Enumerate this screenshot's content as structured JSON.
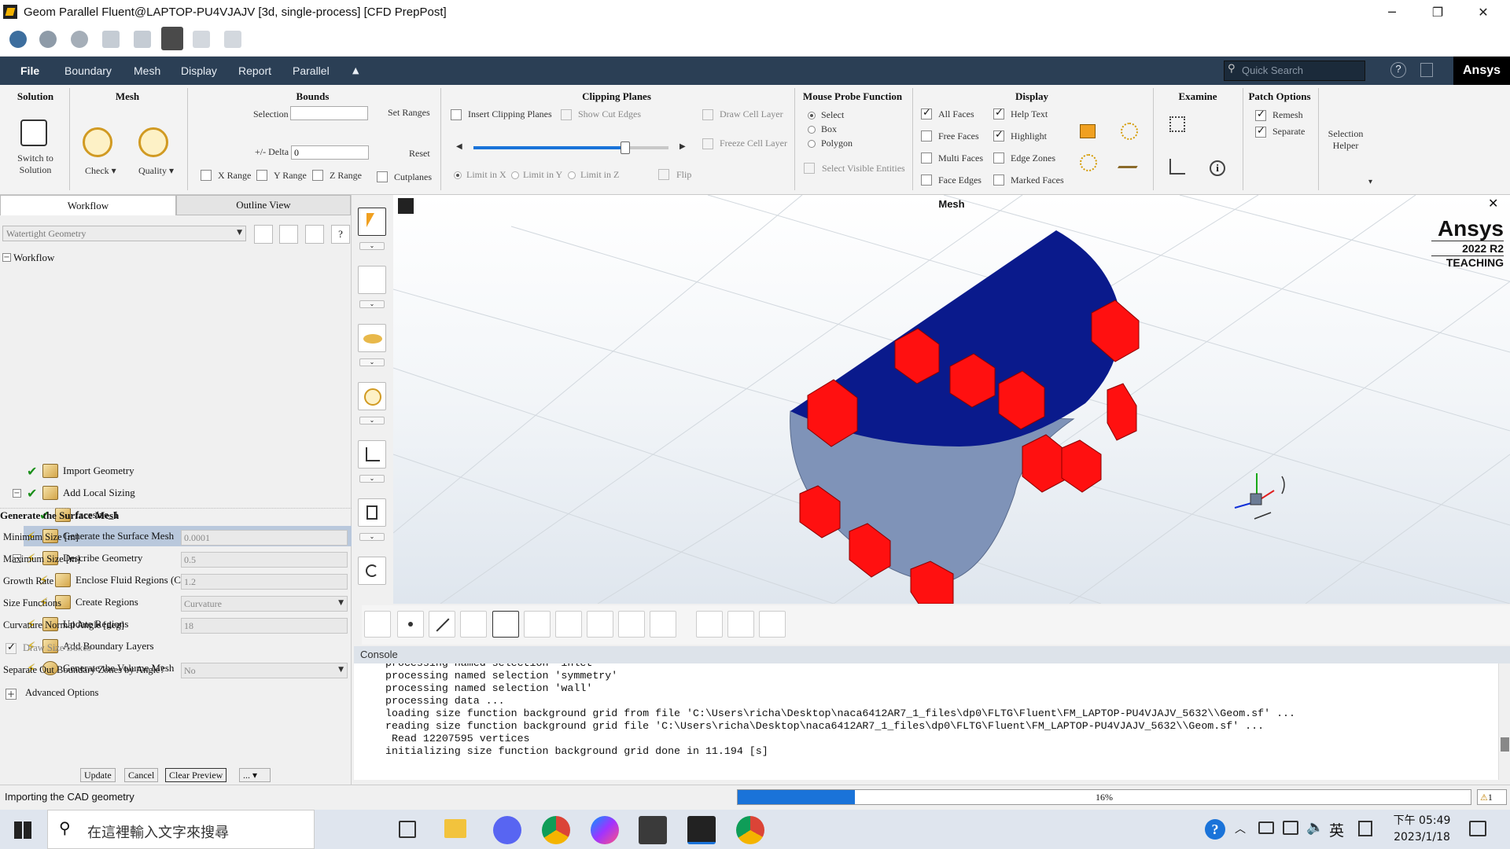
{
  "window": {
    "title": "Geom Parallel Fluent@LAPTOP-PU4VJAJV  [3d, single-process] [CFD PrepPost]",
    "min": "─",
    "max": "❐",
    "close": "✕"
  },
  "menu": {
    "items": [
      "File",
      "Boundary",
      "Mesh",
      "Display",
      "Report",
      "Parallel"
    ],
    "quick_search_placeholder": "Quick Search",
    "brand": "Ansys"
  },
  "ribbon": {
    "solution": {
      "title": "Solution",
      "switch_label": "Switch to Solution"
    },
    "mesh": {
      "title": "Mesh",
      "check": "Check",
      "quality": "Quality"
    },
    "bounds": {
      "title": "Bounds",
      "selection": "Selection",
      "set_ranges": "Set Ranges",
      "delta_label": "+/- Delta",
      "delta_value": "0",
      "reset": "Reset",
      "x_range": "X Range",
      "y_range": "Y Range",
      "z_range": "Z Range",
      "cutplanes": "Cutplanes"
    },
    "clipping": {
      "title": "Clipping Planes",
      "insert": "Insert Clipping Planes",
      "show_cut_edges": "Show Cut Edges",
      "draw_cell_layer": "Draw Cell Layer",
      "freeze_cell_layer": "Freeze Cell Layer",
      "limit_x": "Limit in X",
      "limit_y": "Limit in Y",
      "limit_z": "Limit in Z",
      "flip": "Flip",
      "slider_fraction": 0.78
    },
    "probe": {
      "title": "Mouse Probe Function",
      "select": "Select",
      "box": "Box",
      "polygon": "Polygon",
      "select_visible": "Select Visible Entities"
    },
    "display": {
      "title": "Display",
      "all_faces": "All Faces",
      "free_faces": "Free Faces",
      "multi_faces": "Multi Faces",
      "face_edges": "Face Edges",
      "help_text": "Help Text",
      "highlight": "Highlight",
      "edge_zones": "Edge Zones",
      "marked_faces": "Marked Faces"
    },
    "examine": {
      "title": "Examine"
    },
    "patch": {
      "title": "Patch Options",
      "remesh": "Remesh",
      "separate": "Separate"
    },
    "selection_helper": "Selection Helper"
  },
  "leftpanel": {
    "tabs": [
      "Workflow",
      "Outline View"
    ],
    "workflow_type": "Watertight Geometry",
    "tree_root": "Workflow",
    "tasks": [
      {
        "label": "Import Geometry",
        "state": "done"
      },
      {
        "label": "Add Local Sizing",
        "state": "done"
      },
      {
        "label": "facesize_1",
        "state": "done"
      },
      {
        "label": "Generate the Surface Mesh",
        "state": "pending"
      },
      {
        "label": "Describe Geometry",
        "state": "pending"
      },
      {
        "label": "Enclose Fluid Regions (Capping)",
        "state": "pending"
      },
      {
        "label": "Create Regions",
        "state": "pending"
      },
      {
        "label": "Update Regions",
        "state": "pending"
      },
      {
        "label": "Add Boundary Layers",
        "state": "pending"
      },
      {
        "label": "Generate the Volume Mesh",
        "state": "pending"
      }
    ],
    "props_title": "Generate the Surface Mesh",
    "props": [
      {
        "label": "Minimum Size [m]",
        "value": "0.0001"
      },
      {
        "label": "Maximum Size [m]",
        "value": "0.5"
      },
      {
        "label": "Growth Rate",
        "value": "1.2"
      },
      {
        "label": "Size Functions",
        "value": "Curvature"
      },
      {
        "label": "Curvature Normal Angle [deg]",
        "value": "18"
      }
    ],
    "draw_size_boxes": "Draw Size Boxes",
    "separate_label": "Separate Out Boundary Zones by Angle?",
    "separate_value": "No",
    "advanced": "Advanced Options",
    "buttons": {
      "update": "Update",
      "cancel": "Cancel",
      "clear_preview": "Clear Preview",
      "more": "..."
    }
  },
  "viewport": {
    "title": "Mesh",
    "watermark_brand": "Ansys",
    "watermark_version": "2022 R2",
    "watermark_edition": "TEACHING",
    "close": "✕"
  },
  "console": {
    "title": "Console",
    "lines": [
      "processing named selection 'inlet'",
      "processing named selection 'symmetry'",
      "processing named selection 'wall'",
      "processing data ...",
      "loading size function background grid from file 'C:\\Users\\richa\\Desktop\\naca6412AR7_1_files\\dp0\\FLTG\\Fluent\\FM_LAPTOP-PU4VJAJV_5632\\\\Geom.sf' ...",
      "reading size function background grid file 'C:\\Users\\richa\\Desktop\\naca6412AR7_1_files\\dp0\\FLTG\\Fluent\\FM_LAPTOP-PU4VJAJV_5632\\\\Geom.sf' ...",
      " Read 12207595 vertices",
      "initializing size function background grid done in 11.194 [s]"
    ]
  },
  "status": {
    "message": "Importing the CAD geometry",
    "progress_text": "16%",
    "progress": 0.16,
    "warning_count": "1"
  },
  "taskbar": {
    "search_placeholder": "在這裡輸入文字來搜尋",
    "ime": "英",
    "time": "下午 05:49",
    "date": "2023/1/18"
  },
  "colors": {
    "menubar": "#2b3f55",
    "body_blue": "#0a1a8c",
    "body_gray": "#7f93b8",
    "box_red": "#ff1010",
    "progress": "#1a73d9"
  }
}
